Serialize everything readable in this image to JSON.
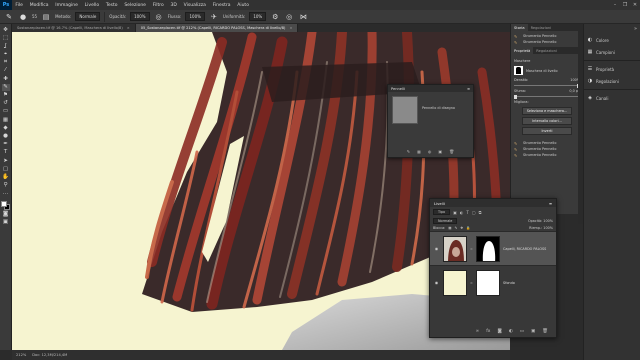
{
  "app": {
    "logo": "Ps",
    "menu": [
      "File",
      "Modifica",
      "Immagine",
      "Livello",
      "Testo",
      "Selezione",
      "Filtro",
      "3D",
      "Visualizza",
      "Finestra",
      "Aiuto"
    ],
    "window_controls": [
      "–",
      "❐",
      "✕"
    ]
  },
  "options_bar": {
    "brush_size": "55",
    "mode_label": "Metodo:",
    "mode_value": "Normale",
    "opacity_label": "Opacità:",
    "opacity_value": "100%",
    "flow_label": "Flusso:",
    "flow_value": "100%",
    "smoothing_label": "Uniformità:",
    "smoothing_value": "10%"
  },
  "tabs": [
    {
      "label": "Sostanzeplacen.tif @ 16.7% (Capelli, Maschera di livello/8)",
      "active": false
    },
    {
      "label": "05_Sostanzeplacen.tif @ 212% (Capelli, RICARDO PALOSS, Maschera di livello/8)",
      "active": true
    }
  ],
  "status": {
    "zoom": "212%",
    "doc": "Doc: 12,3M/214,4M"
  },
  "panel_history": {
    "tabs": [
      "Storia",
      "Regolazioni"
    ],
    "items": [
      "Strumento Pennello",
      "Strumento Pennello"
    ]
  },
  "panel_properties": {
    "tabs": [
      "Proprietà",
      "Regolazioni"
    ],
    "title": "Maschere",
    "mask_label": "Maschera di livello",
    "density_label": "Densità:",
    "density_value": "100%",
    "feather_label": "Sfuma:",
    "feather_value": "0,0 px",
    "refine_label": "Migliora:",
    "btn_select_mask": "Seleziona e maschera...",
    "btn_color_range": "Intervallo colori...",
    "btn_invert": "Inverti",
    "extra_items": [
      "Strumento Pennello",
      "Strumento Pennello",
      "Strumento Pennello"
    ]
  },
  "panel_brush": {
    "title": "Pennelli",
    "brush_name": "Pennello di disegno"
  },
  "panel_layers": {
    "title": "Livelli",
    "filter_label": "Tipo",
    "blend_mode": "Normale",
    "opacity_label": "Opacità:",
    "opacity_value": "100%",
    "lock_label": "Blocca:",
    "fill_label": "Riemp.:",
    "fill_value": "100%",
    "layers": [
      {
        "name": "Capelli, RICARDO PALOSS",
        "selected": true
      },
      {
        "name": "Sfondo",
        "selected": false
      }
    ]
  },
  "dock": {
    "groups": [
      {
        "icon": "palette-icon",
        "label": "Colore"
      },
      {
        "icon": "swatches-icon",
        "label": "Campioni"
      },
      {
        "icon": "properties-icon",
        "label": "Proprietà"
      },
      {
        "icon": "adjustments-icon",
        "label": "Regolazioni"
      },
      {
        "icon": "layers-icon",
        "label": "Canali"
      }
    ]
  },
  "colors": {
    "canvas_bg": "#f6f4d0",
    "ui_dark": "#2b2b2b",
    "ui_panel": "#3a3a3a"
  }
}
